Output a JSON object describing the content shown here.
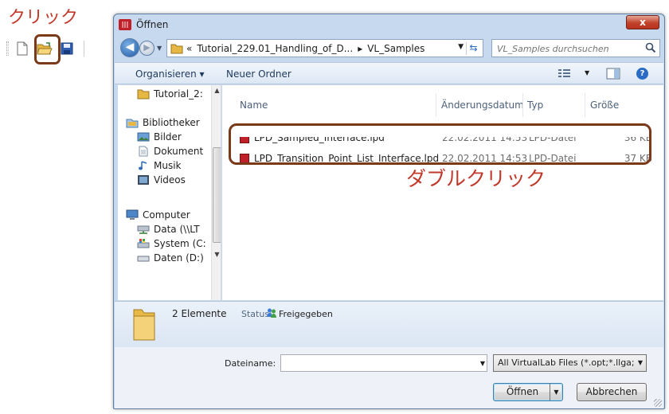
{
  "annotations": {
    "click_label": "クリック",
    "double_click_label": "ダブルクリック",
    "highlight_color": "#7a3a1a",
    "label_color": "#c0392b"
  },
  "toolbar": {
    "buttons": [
      "new-document-icon",
      "open-folder-icon",
      "save-icon"
    ]
  },
  "dialog": {
    "title": "Öffnen",
    "close_label": "x",
    "address": {
      "prefix": "«",
      "crumbs": [
        "Tutorial_229.01_Handling_of_D...",
        "▸",
        "VL_Samples"
      ]
    },
    "search": {
      "placeholder": "VL_Samples durchsuchen"
    },
    "commands": {
      "organize": "Organisieren ▾",
      "new_folder": "Neuer Ordner"
    },
    "nav": {
      "items": [
        {
          "label": "Tutorial_2:",
          "icon": "folder-icon"
        },
        {
          "label": "Bibliotheker",
          "icon": "libraries-icon"
        },
        {
          "label": "Bilder",
          "icon": "pictures-icon"
        },
        {
          "label": "Dokument",
          "icon": "documents-icon"
        },
        {
          "label": "Musik",
          "icon": "music-icon"
        },
        {
          "label": "Videos",
          "icon": "videos-icon"
        },
        {
          "label": "Computer",
          "icon": "computer-icon"
        },
        {
          "label": "Data (\\\\LT",
          "icon": "network-drive-icon"
        },
        {
          "label": "System (C:",
          "icon": "system-drive-icon"
        },
        {
          "label": "Daten (D:)",
          "icon": "drive-icon"
        }
      ]
    },
    "columns": {
      "name": "Name",
      "date": "Änderungsdatum",
      "type": "Typ",
      "size": "Größe"
    },
    "files": [
      {
        "name": "LPD_Sampled_Interface.lpd",
        "date": "22.02.2011 14:53",
        "type": "LPD-Datei",
        "size": "36 KB"
      },
      {
        "name": "LPD_Transition_Point_List_Interface.lpd",
        "date": "22.02.2011 14:53",
        "type": "LPD-Datei",
        "size": "37 KB"
      }
    ],
    "details": {
      "count": "2 Elemente",
      "status_label": "Status:",
      "status_value": "Freigegeben"
    },
    "filename": {
      "label": "Dateiname:",
      "value": ""
    },
    "filter": "All VirtualLab Files  (*.opt;*.llga;",
    "buttons": {
      "open": "Öffnen",
      "cancel": "Abbrechen"
    }
  }
}
